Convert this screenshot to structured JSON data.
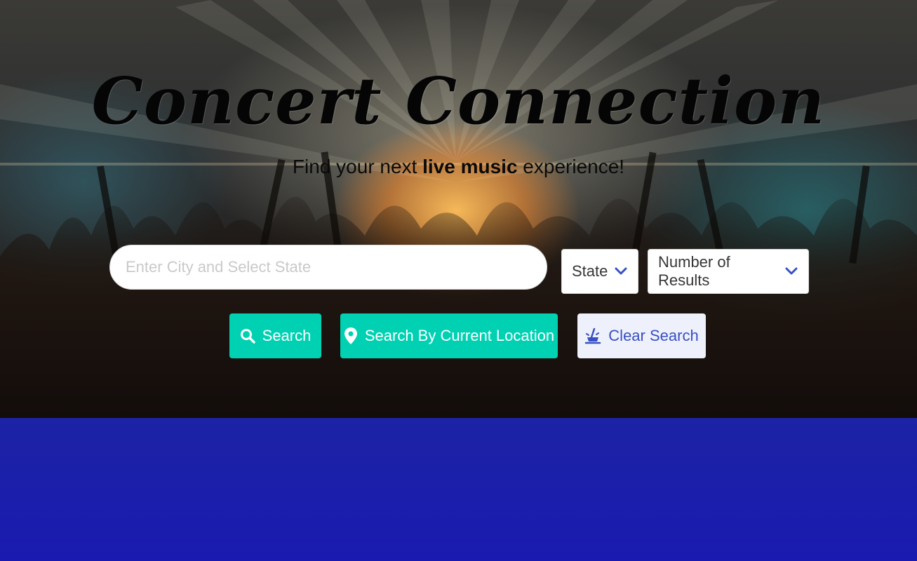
{
  "header": {
    "title": "Concert Connection",
    "subtitle_before": "Find your next ",
    "subtitle_bold": "live music",
    "subtitle_after": " experience!"
  },
  "search": {
    "placeholder": "Enter City and Select State",
    "value": ""
  },
  "filters": {
    "state_label": "State",
    "results_label": "Number of Results"
  },
  "buttons": {
    "search_label": "Search",
    "location_label": "Search By Current Location",
    "clear_label": "Clear Search"
  },
  "icons": {
    "search": "search-icon",
    "location": "map-marker-icon",
    "clear": "broom-icon",
    "dropdown": "chevron-down-icon"
  },
  "colors": {
    "primary": "#00d1b2",
    "link": "#3850c4",
    "lower_background": "#1a1ab0"
  }
}
